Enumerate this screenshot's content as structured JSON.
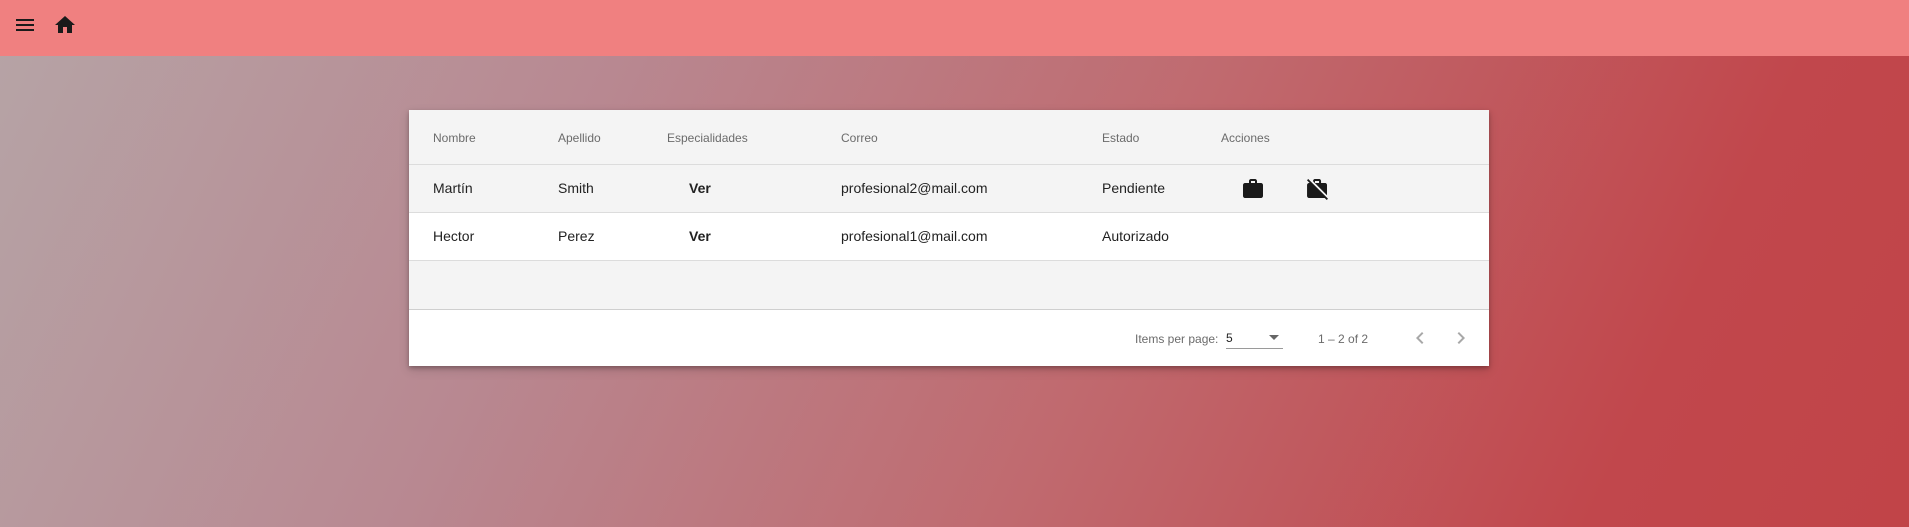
{
  "toolbar": {
    "menu_icon": "menu-icon",
    "home_icon": "home-icon",
    "background_color": "#f08080"
  },
  "table": {
    "columns": [
      "Nombre",
      "Apellido",
      "Especialidades",
      "Correo",
      "Estado",
      "Acciones"
    ],
    "rows": [
      {
        "nombre": "Martín",
        "apellido": "Smith",
        "especialidades": "Ver",
        "correo": "profesional2@mail.com",
        "estado": "Pendiente",
        "actions": [
          "work-icon",
          "work-off-icon"
        ]
      },
      {
        "nombre": "Hector",
        "apellido": "Perez",
        "especialidades": "Ver",
        "correo": "profesional1@mail.com",
        "estado": "Autorizado",
        "actions": []
      }
    ]
  },
  "paginator": {
    "items_per_page_label": "Items per page:",
    "page_size": "5",
    "range_label": "1 – 2 of 2",
    "prev_icon": "chevron-left-icon",
    "next_icon": "chevron-right-icon"
  }
}
